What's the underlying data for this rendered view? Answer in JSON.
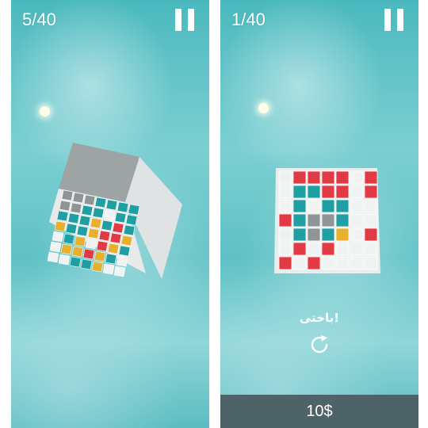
{
  "left_screen": {
    "counter": "5/40",
    "pause_icon": "pause-icon"
  },
  "right_screen": {
    "counter": "1/40",
    "pause_icon": "pause-icon",
    "status_text": "باختی!",
    "retry_icon": "restart-icon",
    "price_button": "10$"
  },
  "colors": {
    "teal_tile": "#1f9ea3",
    "yellow_tile": "#e7b02e",
    "red_tile": "#e23a44",
    "white_tile": "#f1f2f2",
    "grey_tile": "#8f9596",
    "price_bar": "#4e6367"
  }
}
